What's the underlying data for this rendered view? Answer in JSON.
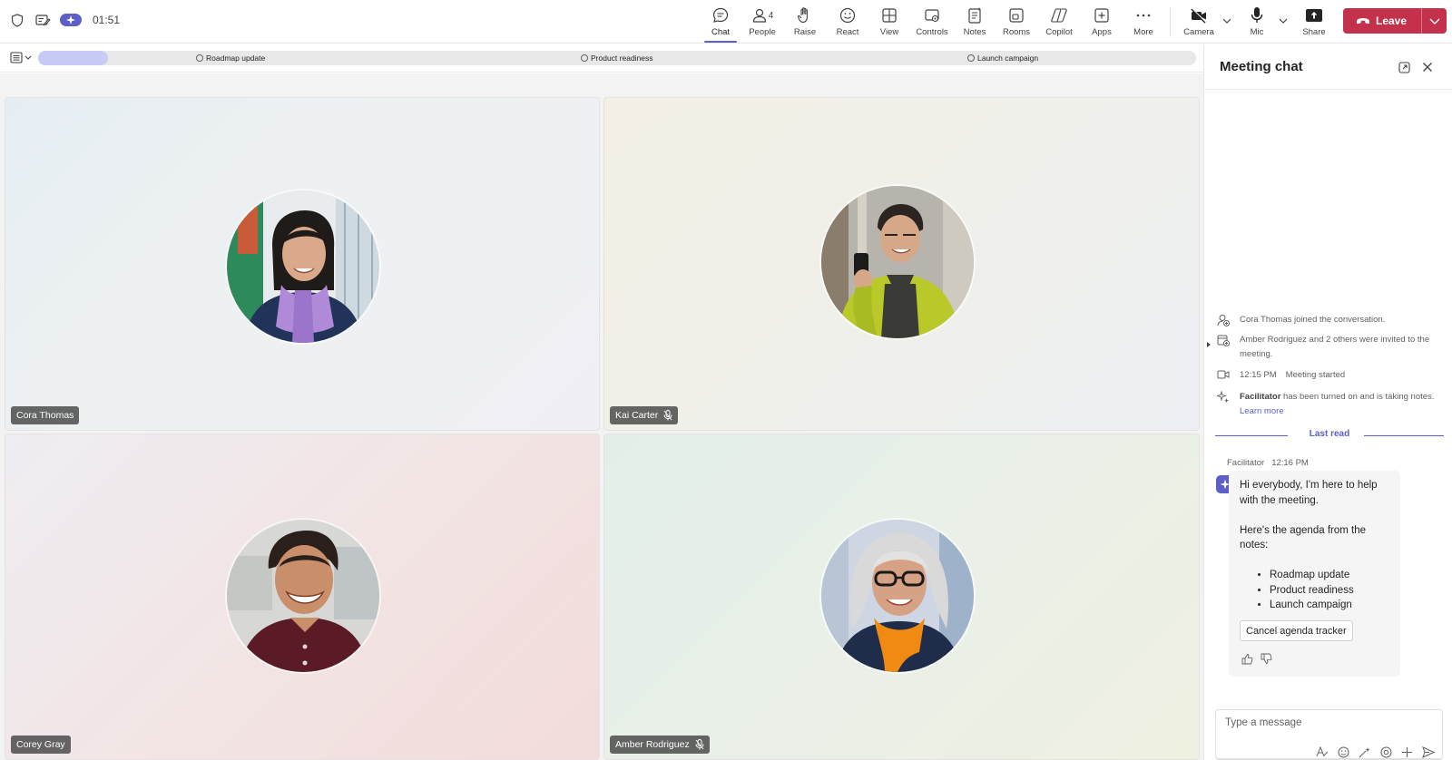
{
  "topbar": {
    "timer": "01:51",
    "people_count": "4",
    "items": [
      {
        "label": "Chat",
        "icon": "chat-icon"
      },
      {
        "label": "People",
        "icon": "people-icon"
      },
      {
        "label": "Raise",
        "icon": "raise-hand-icon"
      },
      {
        "label": "React",
        "icon": "react-icon"
      },
      {
        "label": "View",
        "icon": "view-icon"
      },
      {
        "label": "Controls",
        "icon": "controls-icon"
      },
      {
        "label": "Notes",
        "icon": "notes-icon"
      },
      {
        "label": "Rooms",
        "icon": "rooms-icon"
      },
      {
        "label": "Copilot",
        "icon": "copilot-icon"
      },
      {
        "label": "Apps",
        "icon": "apps-icon"
      },
      {
        "label": "More",
        "icon": "more-icon"
      },
      {
        "label": "Camera",
        "icon": "camera-off-icon"
      },
      {
        "label": "Mic",
        "icon": "mic-icon"
      },
      {
        "label": "Share",
        "icon": "share-icon"
      }
    ],
    "leave_label": "Leave"
  },
  "agenda": {
    "progress": 0.06,
    "items": [
      {
        "label": "Roadmap update"
      },
      {
        "label": "Product readiness"
      },
      {
        "label": "Launch campaign"
      }
    ]
  },
  "participants": [
    {
      "name": "Cora Thomas",
      "muted": false
    },
    {
      "name": "Kai Carter",
      "muted": true
    },
    {
      "name": "Corey Gray",
      "muted": false
    },
    {
      "name": "Amber Rodriguez",
      "muted": true
    }
  ],
  "chat": {
    "title": "Meeting chat",
    "events": [
      {
        "icon": "person-joined-icon",
        "text": "Cora Thomas joined the conversation."
      },
      {
        "icon": "calendar-add-icon",
        "text": "Amber Rodriguez and 2 others were invited to the meeting."
      },
      {
        "icon": "video-icon",
        "time": "12:15 PM",
        "text": "Meeting started"
      },
      {
        "icon": "sparkle-icon",
        "strong": "Facilitator",
        "text": " has been turned on and is taking notes.",
        "link": "Learn more"
      }
    ],
    "last_read": "Last read",
    "message": {
      "sender": "Facilitator",
      "time": "12:16 PM",
      "para1": "Hi everybody, I'm here to help with the meeting.",
      "para2": "Here's the agenda from the notes:",
      "bullets": [
        "Roadmap update",
        "Product readiness",
        "Launch campaign"
      ],
      "button": "Cancel agenda tracker"
    },
    "composer_placeholder": "Type a message"
  },
  "colors": {
    "accent": "#5b5fc7",
    "leave": "#c4314b",
    "agenda_progress": "#c7cbf5"
  }
}
